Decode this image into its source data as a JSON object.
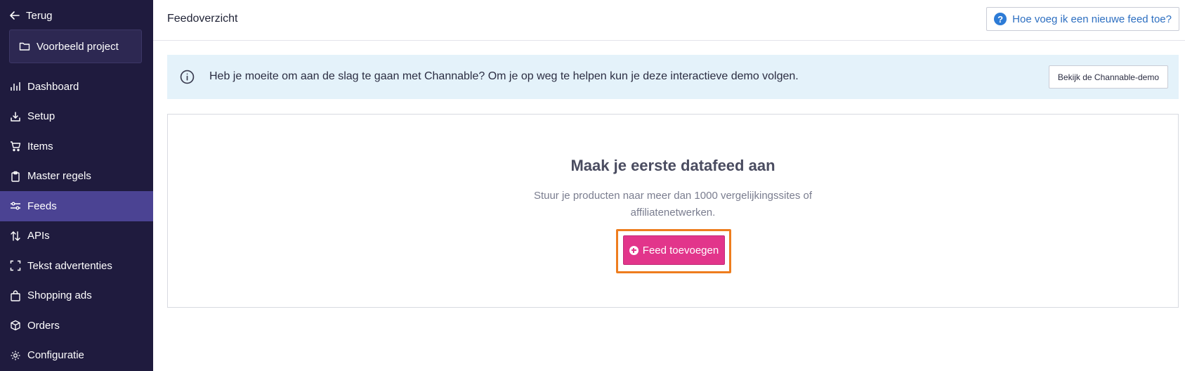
{
  "sidebar": {
    "back_label": "Terug",
    "project_name": "Voorbeeld project",
    "active_item": "Feeds",
    "items": [
      {
        "label": "Dashboard",
        "icon": "bar-chart-icon"
      },
      {
        "label": "Setup",
        "icon": "download-tray-icon"
      },
      {
        "label": "Items",
        "icon": "cart-icon"
      },
      {
        "label": "Master regels",
        "icon": "clipboard-icon"
      },
      {
        "label": "Feeds",
        "icon": "sliders-icon"
      },
      {
        "label": "APIs",
        "icon": "arrows-up-down-icon"
      },
      {
        "label": "Tekst advertenties",
        "icon": "frame-corners-icon"
      },
      {
        "label": "Shopping ads",
        "icon": "shopping-bag-icon"
      },
      {
        "label": "Orders",
        "icon": "box-icon"
      },
      {
        "label": "Configuratie",
        "icon": "gear-icon"
      }
    ]
  },
  "header": {
    "title": "Feedoverzicht",
    "help_label": "Hoe voeg ik een nieuwe feed toe?"
  },
  "banner": {
    "text": "Heb je moeite om aan de slag te gaan met Channable? Om je op weg te helpen kun je deze interactieve demo volgen.",
    "demo_button": "Bekijk de Channable-demo"
  },
  "empty_state": {
    "title": "Maak je eerste datafeed aan",
    "description": "Stuur je producten naar meer dan 1000 vergelijkingssites of affiliatenetwerken.",
    "add_button": "Feed toevoegen"
  },
  "colors": {
    "sidebar_bg": "#1f1b3e",
    "sidebar_active": "#4b4393",
    "primary_button": "#e2358b",
    "highlight_outline": "#ee7d1e",
    "banner_bg": "#e4f2fa",
    "link_blue": "#2d6fc1"
  }
}
